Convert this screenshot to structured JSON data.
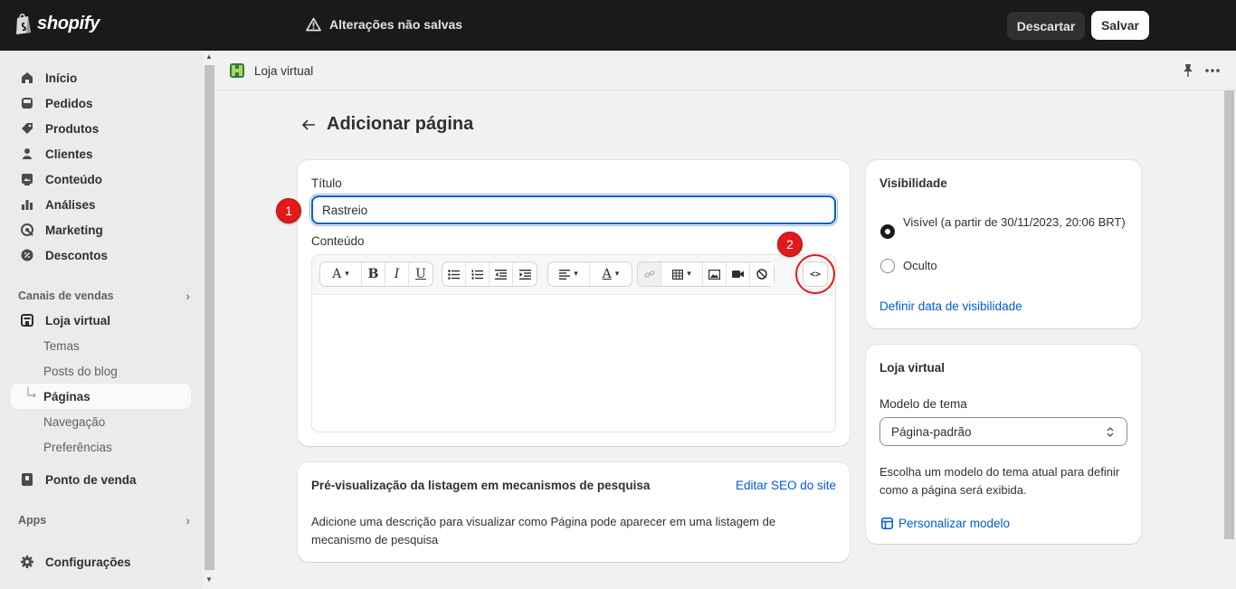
{
  "topbar": {
    "logo_text": "shopify",
    "unsaved_text": "Alterações não salvas",
    "discard_label": "Descartar",
    "save_label": "Salvar"
  },
  "sidebar": {
    "items": [
      {
        "label": "Início",
        "icon": "home-icon"
      },
      {
        "label": "Pedidos",
        "icon": "inbox-icon"
      },
      {
        "label": "Produtos",
        "icon": "tag-icon"
      },
      {
        "label": "Clientes",
        "icon": "person-icon"
      },
      {
        "label": "Conteúdo",
        "icon": "image-icon"
      },
      {
        "label": "Análises",
        "icon": "bar-chart-icon"
      },
      {
        "label": "Marketing",
        "icon": "target-icon"
      },
      {
        "label": "Descontos",
        "icon": "discount-icon"
      }
    ],
    "sales_channels_label": "Canais de vendas",
    "online_store_label": "Loja virtual",
    "sub_items": [
      "Temas",
      "Posts do blog",
      "Páginas",
      "Navegação",
      "Preferências"
    ],
    "pos_label": "Ponto de venda",
    "apps_label": "Apps",
    "settings_label": "Configurações"
  },
  "mainbar": {
    "store_label": "Loja virtual"
  },
  "page": {
    "title": "Adicionar página"
  },
  "content_card": {
    "title_label": "Título",
    "title_value": "Rastreio",
    "content_label": "Conteúdo",
    "annotation_1": "1",
    "annotation_2": "2",
    "html_button_label": "<>"
  },
  "seo_card": {
    "heading": "Pré-visualização da listagem em mecanismos de pesquisa",
    "edit_link": "Editar SEO do site",
    "description": "Adicione uma descrição para visualizar como Página pode aparecer em uma listagem de mecanismo de pesquisa"
  },
  "visibility_card": {
    "heading": "Visibilidade",
    "visible_label": "Visível (a partir de 30/11/2023, 20:06 BRT)",
    "hidden_label": "Oculto",
    "set_date_link": "Definir data de visibilidade",
    "selected": "visible"
  },
  "store_card": {
    "heading": "Loja virtual",
    "template_label": "Modelo de tema",
    "template_value": "Página-padrão",
    "help_text": "Escolha um modelo do tema atual para definir como a página será exibida.",
    "customize_link": "Personalizar modelo"
  },
  "colors": {
    "accent": "#005bd3",
    "annotation": "#e21a1a",
    "topbar": "#1a1a1a"
  }
}
